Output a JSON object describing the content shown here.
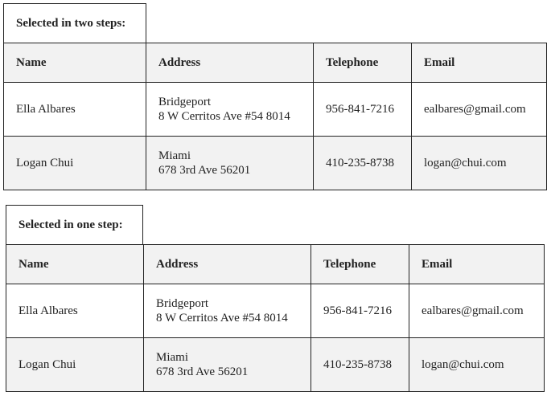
{
  "tables": [
    {
      "caption": "Selected in two steps:",
      "headers": [
        "Name",
        "Address",
        "Telephone",
        "Email"
      ],
      "rows": [
        {
          "name": "Ella Albares",
          "city": "Bridgeport",
          "street": "8 W Cerritos Ave #54 8014",
          "telephone": "956-841-7216",
          "email": "ealbares@gmail.com"
        },
        {
          "name": "Logan Chui",
          "city": "Miami",
          "street": "678 3rd Ave 56201",
          "telephone": "410-235-8738",
          "email": "logan@chui.com"
        }
      ]
    },
    {
      "caption": "Selected in one step:",
      "headers": [
        "Name",
        "Address",
        "Telephone",
        "Email"
      ],
      "rows": [
        {
          "name": "Ella Albares",
          "city": "Bridgeport",
          "street": "8 W Cerritos Ave #54 8014",
          "telephone": "956-841-7216",
          "email": "ealbares@gmail.com"
        },
        {
          "name": "Logan Chui",
          "city": "Miami",
          "street": "678 3rd Ave 56201",
          "telephone": "410-235-8738",
          "email": "logan@chui.com"
        }
      ]
    }
  ],
  "colors": {
    "border": "#222222",
    "header_bg": "#f2f2f2",
    "row_alt_bg": "#f2f2f2"
  }
}
